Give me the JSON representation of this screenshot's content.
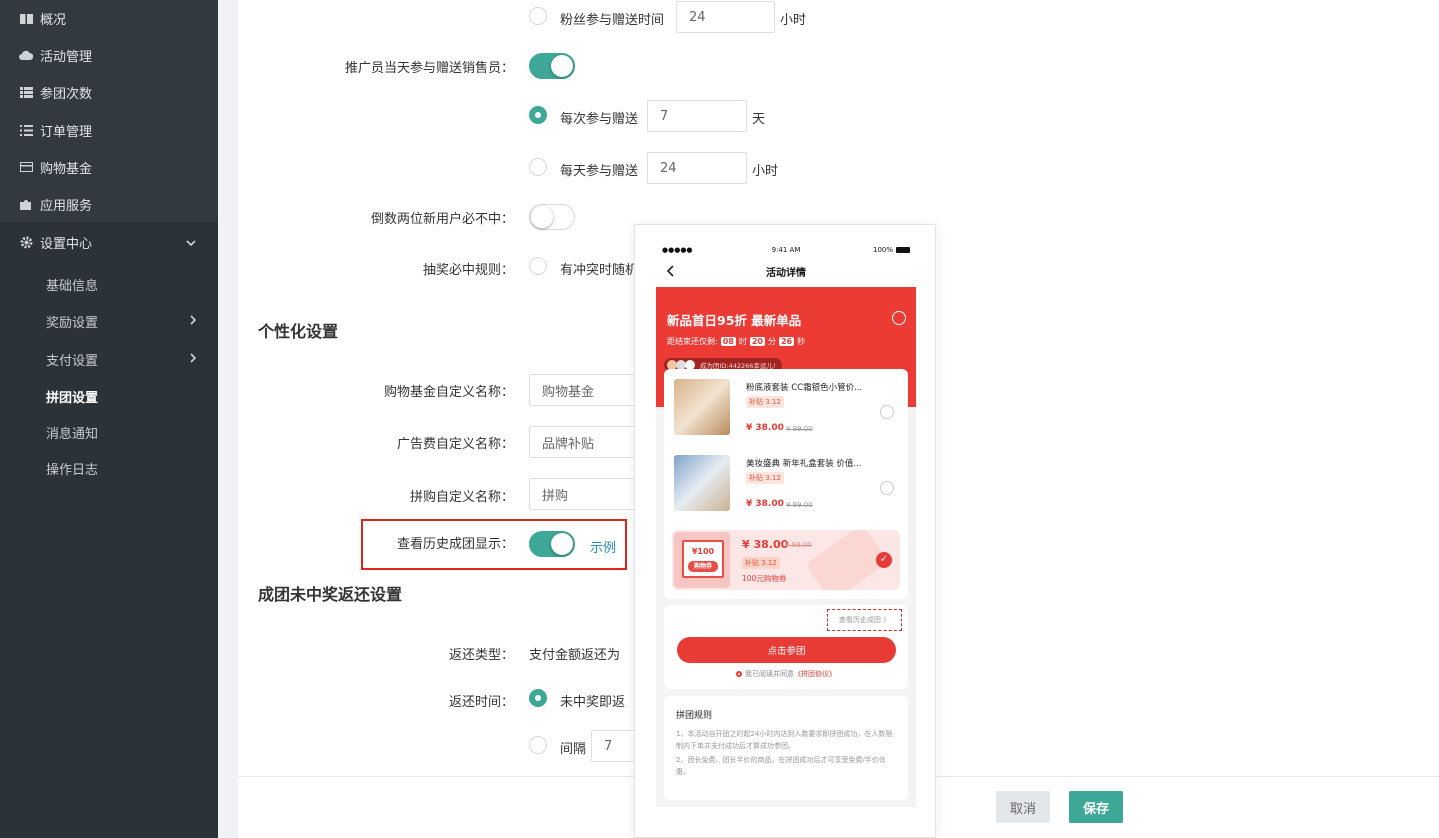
{
  "sidebar": {
    "items": [
      {
        "label": "概况",
        "icon": "book-icon"
      },
      {
        "label": "活动管理",
        "icon": "cloud-icon"
      },
      {
        "label": "参团次数",
        "icon": "list-icon"
      },
      {
        "label": "订单管理",
        "icon": "list-bullets-icon"
      },
      {
        "label": "购物基金",
        "icon": "credit-card-icon"
      },
      {
        "label": "应用服务",
        "icon": "puzzle-icon"
      },
      {
        "label": "设置中心",
        "icon": "gear-icon"
      }
    ],
    "sub_items": [
      {
        "label": "基础信息"
      },
      {
        "label": "奖励设置"
      },
      {
        "label": "支付设置"
      },
      {
        "label": "拼团设置"
      },
      {
        "label": "消息通知"
      },
      {
        "label": "操作日志"
      }
    ],
    "active": "拼团设置"
  },
  "form": {
    "fans_gift_label": "粉丝参与赠送时间",
    "fans_gift_value": "24",
    "fans_gift_unit": "小时",
    "promoter_label": "推广员当天参与赠送销售员：",
    "promoter_on": true,
    "each_time_label": "每次参与赠送",
    "each_time_value": "7",
    "each_time_unit": "天",
    "daily_label": "每天参与赠送",
    "daily_value": "24",
    "daily_unit": "小时",
    "last_two_label": "倒数两位新用户必不中：",
    "lottery_label": "抽奖必中规则：",
    "lottery_option": "有冲突时随机"
  },
  "personal": {
    "title": "个性化设置",
    "fund_label": "购物基金自定义名称：",
    "fund_value": "购物基金",
    "ad_label": "广告费自定义名称：",
    "ad_value": "品牌补贴",
    "group_label": "拼购自定义名称：",
    "group_value": "拼购",
    "history_label": "查看历史成团显示：",
    "history_on": true,
    "example_link": "示例"
  },
  "refund": {
    "title": "成团未中奖返还设置",
    "type_label": "返还类型：",
    "type_value": "支付金额返还为",
    "time_label": "返还时间：",
    "time_option": "未中奖即返",
    "interval_label": "间隔",
    "interval_value": "7"
  },
  "footer": {
    "cancel": "取消",
    "save": "保存"
  },
  "preview": {
    "status_time": "9:41 AM",
    "status_battery": "100%",
    "status_signal": "●●●●● ",
    "title": "活动详情",
    "banner_title": "新品首日95折 最新单品",
    "countdown_prefix": "距结束还仅剩:",
    "cd_h": "08",
    "cd_h_unit": "时",
    "cd_m": "20",
    "cd_m_unit": "分",
    "cd_s": "26",
    "cd_s_unit": "秒",
    "pill_text": "成为团ID:442266幸运儿!",
    "products": [
      {
        "name": "粉底液套装 CC霜银色小管价...",
        "tag": "补贴 3.12",
        "price": "¥ 38.00",
        "old": "¥ 99.00"
      },
      {
        "name": "美妆盛典 新年礼盒套装 价值...",
        "tag": "补贴 3.12",
        "price": "¥ 38.00",
        "old": "¥ 99.00"
      }
    ],
    "coupon": {
      "face": "¥100",
      "face_tag": "购物券",
      "price": "¥ 38.00",
      "old": "¥ 99.00",
      "tag": "补贴 3.12",
      "desc": "100元购物券"
    },
    "history_link": "查看历史成团 〉",
    "join_button": "点击参团",
    "agree_prefix": "我已阅读并同意",
    "agree_link": "《拼团协议》",
    "rules_title": "拼团规则",
    "rule1": "1、本活动自开团之时起24小时内达到人数要求即拼团成功，在人数限制内下单并支付成功后才算成功参团。",
    "rule2": "2、团长免费、团长半价的商品，在拼团成功后才可享受免费/半价优惠。"
  },
  "colors": {
    "accent": "#3da896",
    "sidebar_bg": "#2b3338",
    "highlight": "#e0251a",
    "brand_red": "#e83b36",
    "link": "#2a8fbd"
  }
}
